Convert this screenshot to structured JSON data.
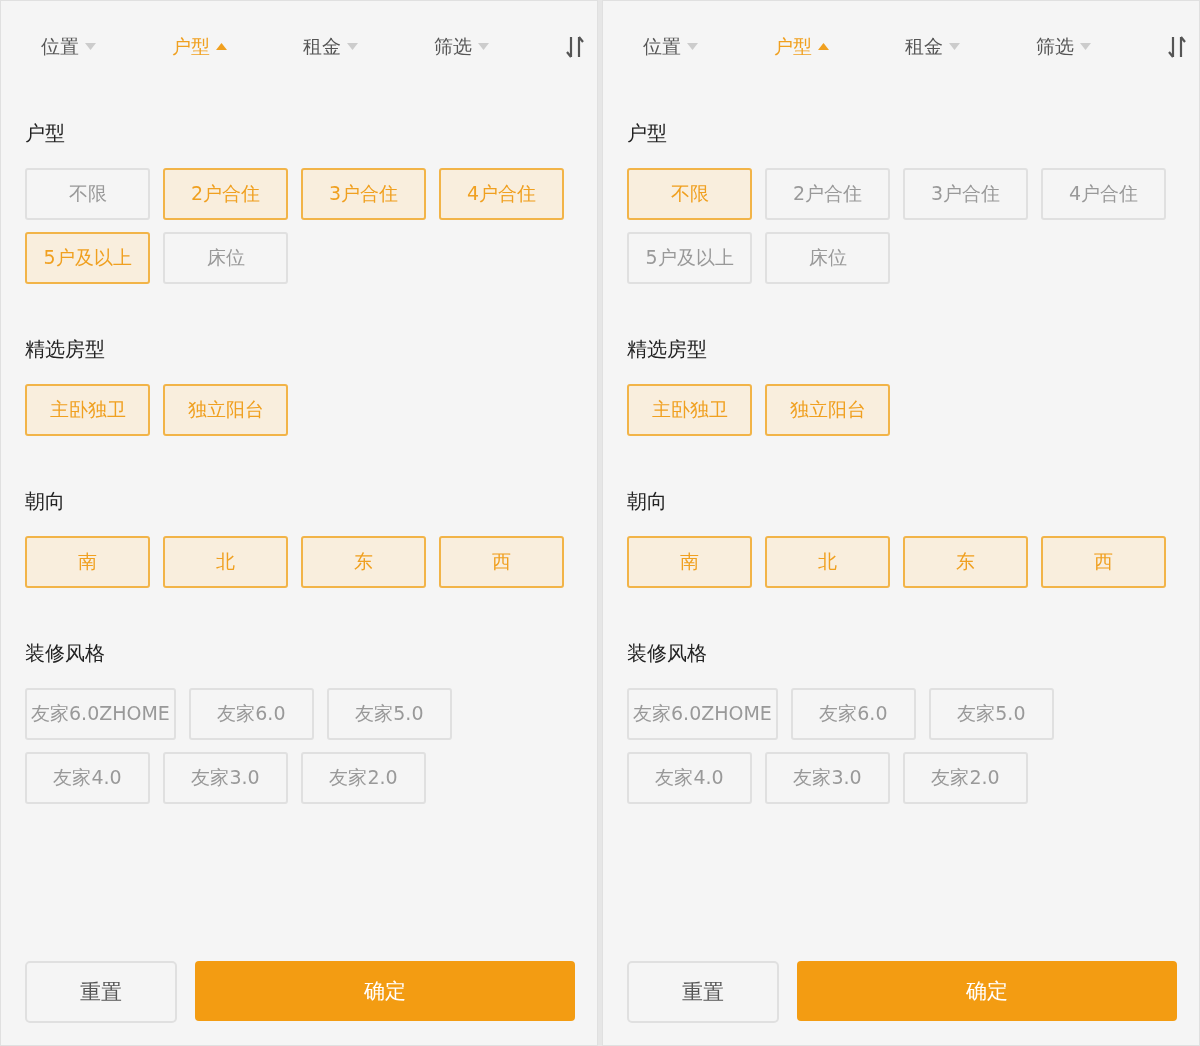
{
  "panels": [
    {
      "tabs": [
        {
          "label": "位置",
          "selected": false
        },
        {
          "label": "户型",
          "selected": true
        },
        {
          "label": "租金",
          "selected": false
        },
        {
          "label": "筛选",
          "selected": false
        }
      ],
      "sections": [
        {
          "title": "户型",
          "options": [
            {
              "label": "不限",
              "selected": false
            },
            {
              "label": "2户合住",
              "selected": true
            },
            {
              "label": "3户合住",
              "selected": true
            },
            {
              "label": "4户合住",
              "selected": true
            },
            {
              "label": "5户及以上",
              "selected": true
            },
            {
              "label": "床位",
              "selected": false
            }
          ]
        },
        {
          "title": "精选房型",
          "options": [
            {
              "label": "主卧独卫",
              "selected": true
            },
            {
              "label": "独立阳台",
              "selected": true
            }
          ]
        },
        {
          "title": "朝向",
          "options": [
            {
              "label": "南",
              "selected": true
            },
            {
              "label": "北",
              "selected": true
            },
            {
              "label": "东",
              "selected": true
            },
            {
              "label": "西",
              "selected": true
            }
          ]
        },
        {
          "title": "装修风格",
          "options": [
            {
              "label": "友家6.0ZHOME",
              "selected": false
            },
            {
              "label": "友家6.0",
              "selected": false
            },
            {
              "label": "友家5.0",
              "selected": false
            },
            {
              "label": "友家4.0",
              "selected": false
            },
            {
              "label": "友家3.0",
              "selected": false
            },
            {
              "label": "友家2.0",
              "selected": false
            }
          ]
        }
      ],
      "reset": "重置",
      "confirm": "确定"
    },
    {
      "tabs": [
        {
          "label": "位置",
          "selected": false
        },
        {
          "label": "户型",
          "selected": true
        },
        {
          "label": "租金",
          "selected": false
        },
        {
          "label": "筛选",
          "selected": false
        }
      ],
      "sections": [
        {
          "title": "户型",
          "options": [
            {
              "label": "不限",
              "selected": true
            },
            {
              "label": "2户合住",
              "selected": false
            },
            {
              "label": "3户合住",
              "selected": false
            },
            {
              "label": "4户合住",
              "selected": false
            },
            {
              "label": "5户及以上",
              "selected": false
            },
            {
              "label": "床位",
              "selected": false
            }
          ]
        },
        {
          "title": "精选房型",
          "options": [
            {
              "label": "主卧独卫",
              "selected": true
            },
            {
              "label": "独立阳台",
              "selected": true
            }
          ]
        },
        {
          "title": "朝向",
          "options": [
            {
              "label": "南",
              "selected": true
            },
            {
              "label": "北",
              "selected": true
            },
            {
              "label": "东",
              "selected": true
            },
            {
              "label": "西",
              "selected": true
            }
          ]
        },
        {
          "title": "装修风格",
          "options": [
            {
              "label": "友家6.0ZHOME",
              "selected": false
            },
            {
              "label": "友家6.0",
              "selected": false
            },
            {
              "label": "友家5.0",
              "selected": false
            },
            {
              "label": "友家4.0",
              "selected": false
            },
            {
              "label": "友家3.0",
              "selected": false
            },
            {
              "label": "友家2.0",
              "selected": false
            }
          ]
        }
      ],
      "reset": "重置",
      "confirm": "确定"
    }
  ]
}
